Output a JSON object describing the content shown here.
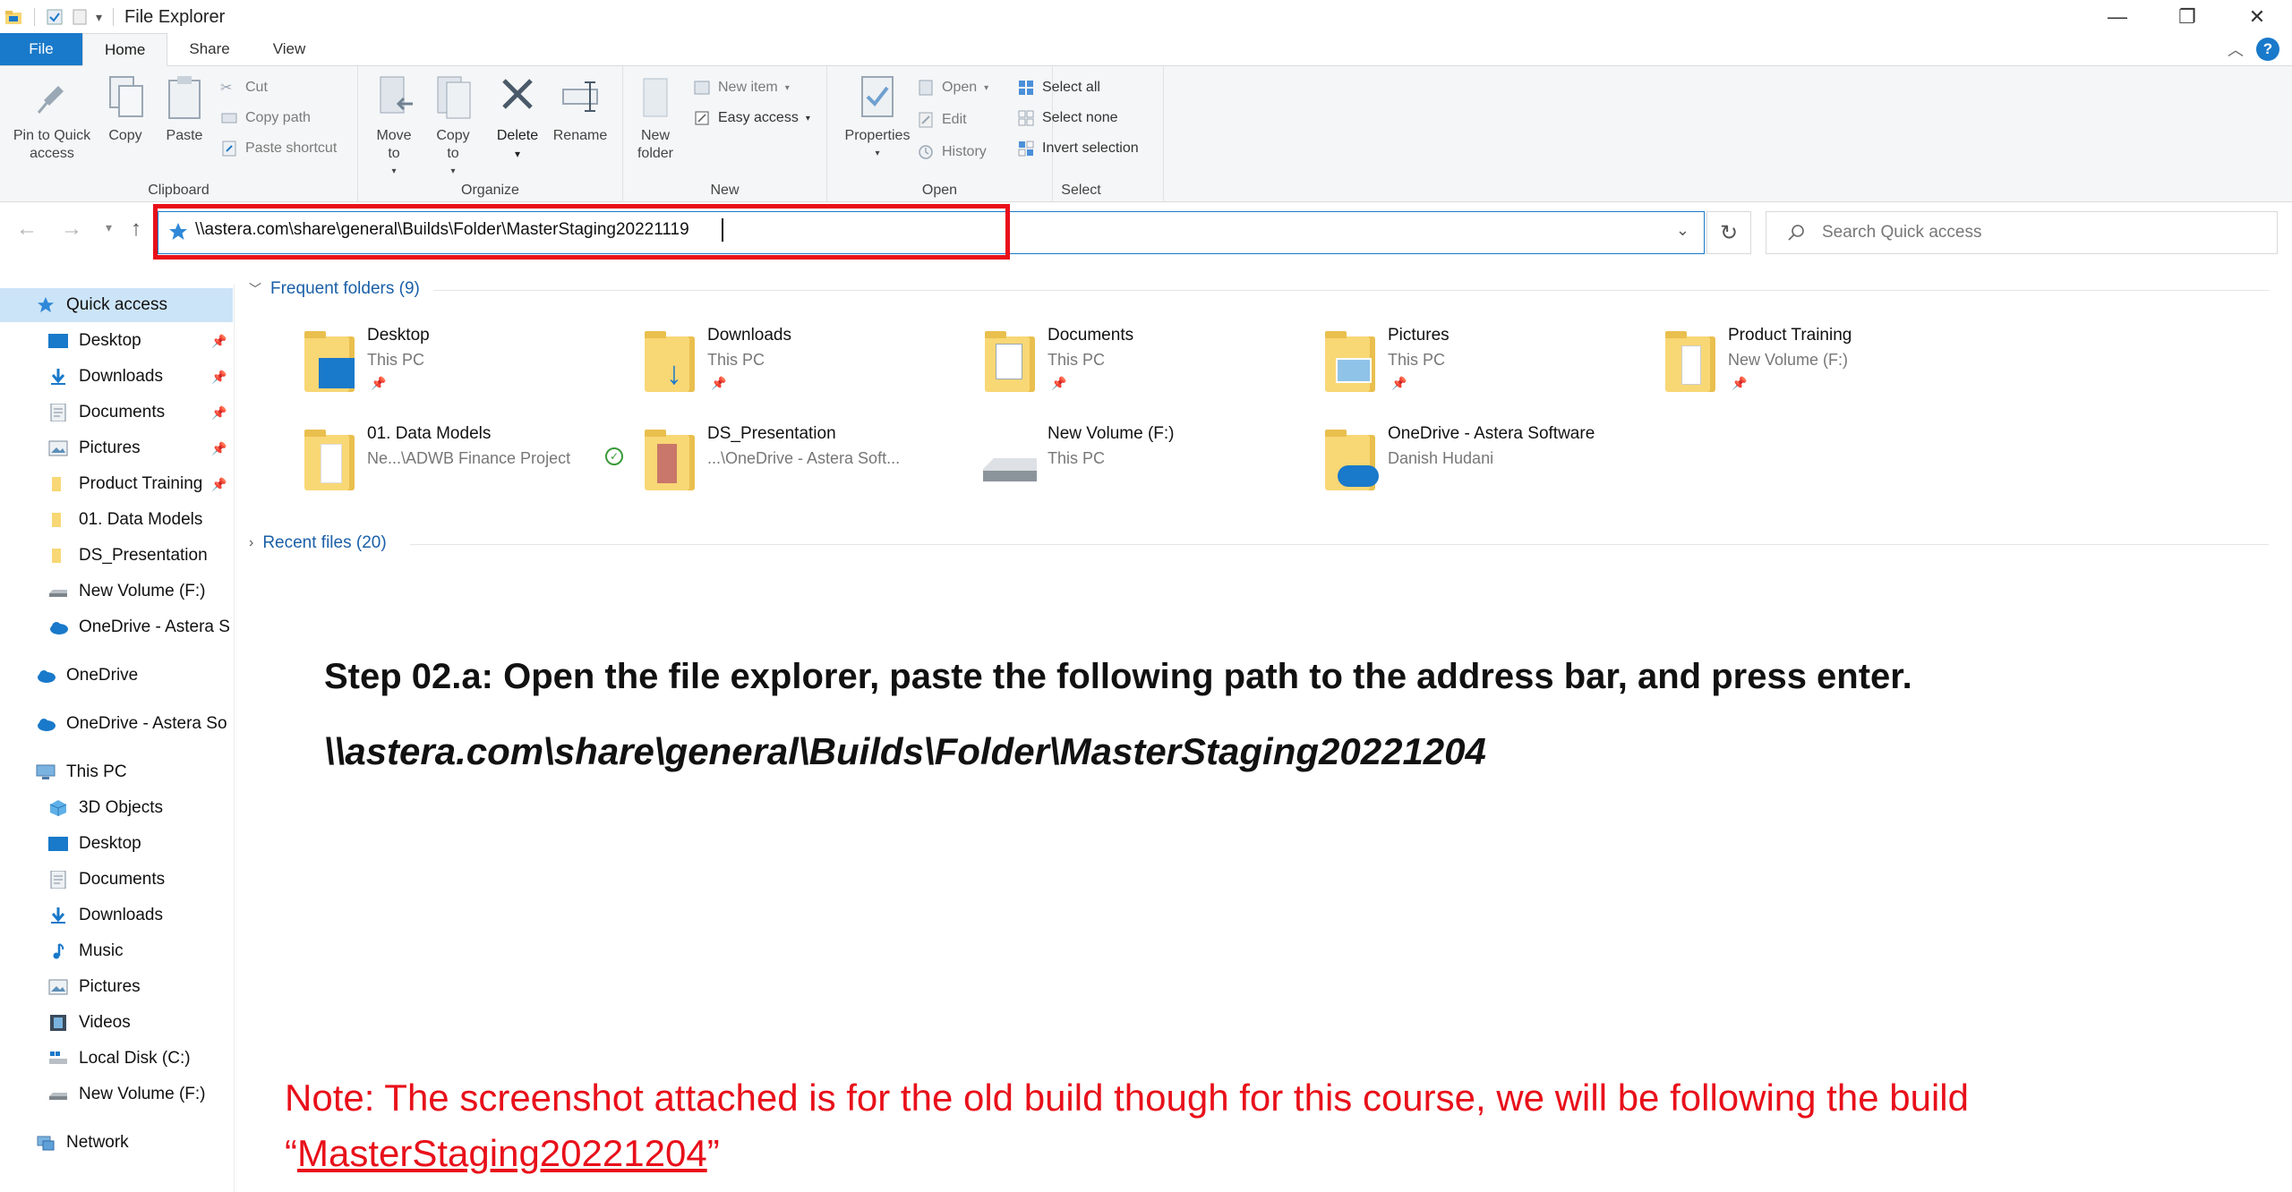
{
  "window": {
    "title": "File Explorer",
    "controls": [
      "—",
      "❐",
      "✕"
    ]
  },
  "tabs": [
    {
      "label": "File"
    },
    {
      "label": "Home"
    },
    {
      "label": "Share"
    },
    {
      "label": "View"
    }
  ],
  "help_label": "?",
  "ribbon": {
    "clipboard": {
      "label": "Clipboard",
      "pin": "Pin to Quick access",
      "copy": "Copy",
      "paste": "Paste",
      "cut": "Cut",
      "copy_path": "Copy path",
      "paste_shortcut": "Paste shortcut"
    },
    "organize": {
      "label": "Organize",
      "move_to": "Move to",
      "copy_to": "Copy to",
      "delete": "Delete",
      "rename": "Rename"
    },
    "new": {
      "label": "New",
      "new_folder": "New folder",
      "new_item": "New item",
      "easy_access": "Easy access"
    },
    "open": {
      "label": "Open",
      "properties": "Properties",
      "open": "Open",
      "edit": "Edit",
      "history": "History"
    },
    "select": {
      "label": "Select",
      "select_all": "Select all",
      "select_none": "Select none",
      "invert_selection": "Invert selection"
    }
  },
  "address": {
    "path": "\\\\astera.com\\share\\general\\Builds\\Folder\\MasterStaging20221119",
    "search_placeholder": "Search Quick access"
  },
  "nav": {
    "quick_access": "Quick access",
    "pinned": [
      {
        "label": "Desktop"
      },
      {
        "label": "Downloads"
      },
      {
        "label": "Documents"
      },
      {
        "label": "Pictures"
      },
      {
        "label": "Product Training"
      },
      {
        "label": "01. Data Models"
      },
      {
        "label": "DS_Presentation"
      },
      {
        "label": "New Volume (F:)"
      },
      {
        "label": "OneDrive - Astera S"
      }
    ],
    "onedrive": "OneDrive",
    "onedrive_astera": "OneDrive - Astera So",
    "this_pc": "This PC",
    "this_pc_items": [
      {
        "label": "3D Objects"
      },
      {
        "label": "Desktop"
      },
      {
        "label": "Documents"
      },
      {
        "label": "Downloads"
      },
      {
        "label": "Music"
      },
      {
        "label": "Pictures"
      },
      {
        "label": "Videos"
      },
      {
        "label": "Local Disk (C:)"
      },
      {
        "label": "New Volume (F:)"
      }
    ],
    "network": "Network"
  },
  "content": {
    "frequent_header": "Frequent folders (9)",
    "recent_header": "Recent files (20)",
    "folders": [
      {
        "name": "Desktop",
        "sub": "This PC"
      },
      {
        "name": "Downloads",
        "sub": "This PC"
      },
      {
        "name": "Documents",
        "sub": "This PC"
      },
      {
        "name": "Pictures",
        "sub": "This PC"
      },
      {
        "name": "Product Training",
        "sub": "New Volume (F:)"
      },
      {
        "name": "01. Data Models",
        "sub": "Ne...\\ADWB Finance Project"
      },
      {
        "name": "DS_Presentation",
        "sub": "...\\OneDrive - Astera Soft..."
      },
      {
        "name": "New Volume (F:)",
        "sub": "This PC"
      },
      {
        "name": "OneDrive - Astera Software",
        "sub": "Danish Hudani"
      }
    ]
  },
  "instructions": {
    "step": "Step 02.a: Open the file explorer, paste the following path to the address bar, and press enter.",
    "path": "\\\\astera.com\\share\\general\\Builds\\Folder\\MasterStaging20221204",
    "note_prefix": "Note: The screenshot attached is for the old build though for this course, we will be following the build",
    "note_open_quote": "“",
    "note_build": "MasterStaging20221204",
    "note_close_quote": "”"
  },
  "colors": {
    "accent": "#1979ca",
    "highlight": "#e8101a",
    "selected_nav": "#cce4f7",
    "folder": "#f8d775"
  }
}
